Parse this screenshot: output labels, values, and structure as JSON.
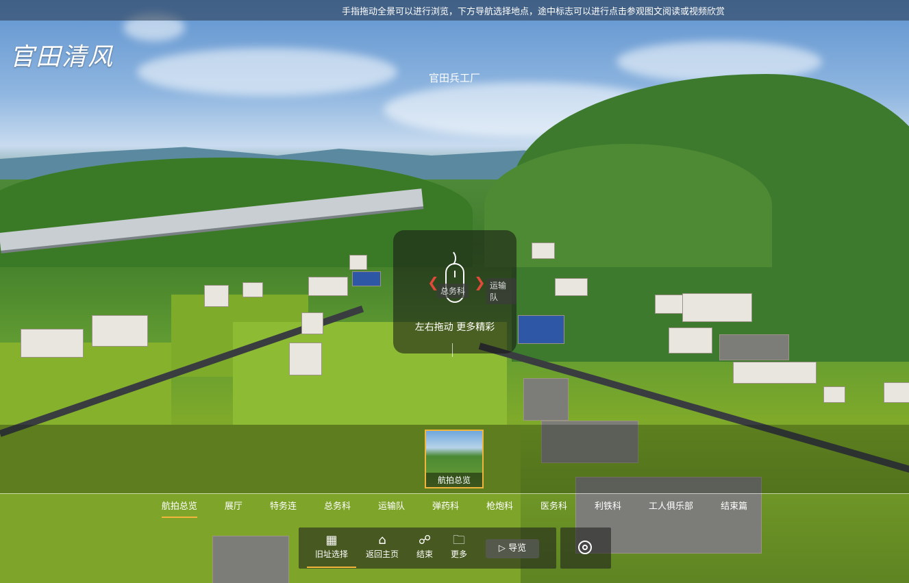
{
  "top_notice": "手指拖动全景可以进行浏览，下方导航选择地点，途中标志可以进行点击参观图文阅读或视频欣赏",
  "logo": "官田清风",
  "scene_title": "官田兵工厂",
  "hint": {
    "text": "左右拖动 更多精彩",
    "tag_left": "总务科",
    "tag_right": "运输队"
  },
  "thumbnail": {
    "label": "航拍总览",
    "selected": true
  },
  "groups": [
    {
      "label": "航拍总览",
      "active": true
    },
    {
      "label": "展厅"
    },
    {
      "label": "特务连"
    },
    {
      "label": "总务科"
    },
    {
      "label": "运输队"
    },
    {
      "label": "弹药科"
    },
    {
      "label": "枪炮科"
    },
    {
      "label": "医务科"
    },
    {
      "label": "利铁科"
    },
    {
      "label": "工人俱乐部"
    },
    {
      "label": "结束篇"
    }
  ],
  "toolbar": {
    "old_site": "旧址选择",
    "home": "返回主页",
    "end": "结束",
    "more": "更多",
    "guide": "导览"
  },
  "colors": {
    "accent": "#f2b63d",
    "hint_arrow": "#e04a3a"
  }
}
